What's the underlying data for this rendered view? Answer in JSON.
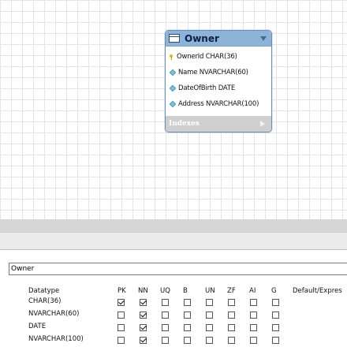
{
  "entity": {
    "title": "Owner",
    "columns": [
      {
        "label": "OwnerId CHAR(36)",
        "kind": "key-icon"
      },
      {
        "label": "Name NVARCHAR(60)",
        "kind": "diamond-icon"
      },
      {
        "label": "DateOfBirth DATE",
        "kind": "diamond-icon"
      },
      {
        "label": "Address NVARCHAR(100)",
        "kind": "diamond-icon"
      }
    ],
    "indexes_label": "Indexes"
  },
  "editor": {
    "table_name": "Owner",
    "headers": {
      "datatype": "Datatype",
      "pk": "PK",
      "nn": "NN",
      "uq": "UQ",
      "b": "B",
      "un": "UN",
      "zf": "ZF",
      "ai": "AI",
      "g": "G",
      "default": "Default/Expres"
    },
    "rows": [
      {
        "datatype": "CHAR(36)",
        "pk": true,
        "nn": true,
        "uq": false,
        "b": false,
        "un": false,
        "zf": false,
        "ai": false,
        "g": false
      },
      {
        "datatype": "NVARCHAR(60)",
        "pk": false,
        "nn": true,
        "uq": false,
        "b": false,
        "un": false,
        "zf": false,
        "ai": false,
        "g": false
      },
      {
        "datatype": "DATE",
        "pk": false,
        "nn": true,
        "uq": false,
        "b": false,
        "un": false,
        "zf": false,
        "ai": false,
        "g": false
      },
      {
        "datatype": "NVARCHAR(100)",
        "pk": false,
        "nn": true,
        "uq": false,
        "b": false,
        "un": false,
        "zf": false,
        "ai": false,
        "g": false
      }
    ]
  }
}
